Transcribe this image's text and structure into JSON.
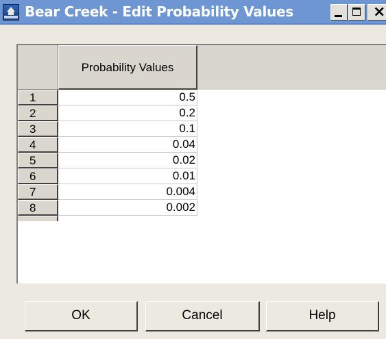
{
  "window": {
    "title": "Bear Creek - Edit Probability Values",
    "icon": "app-icon"
  },
  "table": {
    "column_header": "Probability Values",
    "rows": [
      {
        "index": "1",
        "value": "0.5"
      },
      {
        "index": "2",
        "value": "0.2"
      },
      {
        "index": "3",
        "value": "0.1"
      },
      {
        "index": "4",
        "value": "0.04"
      },
      {
        "index": "5",
        "value": "0.02"
      },
      {
        "index": "6",
        "value": "0.01"
      },
      {
        "index": "7",
        "value": "0.004"
      },
      {
        "index": "8",
        "value": "0.002"
      }
    ]
  },
  "buttons": {
    "ok": "OK",
    "cancel": "Cancel",
    "help": "Help"
  },
  "colors": {
    "titlebar": "#6e96d2",
    "window_bg": "#ece9e0",
    "header_bg": "#d9d6ce"
  }
}
